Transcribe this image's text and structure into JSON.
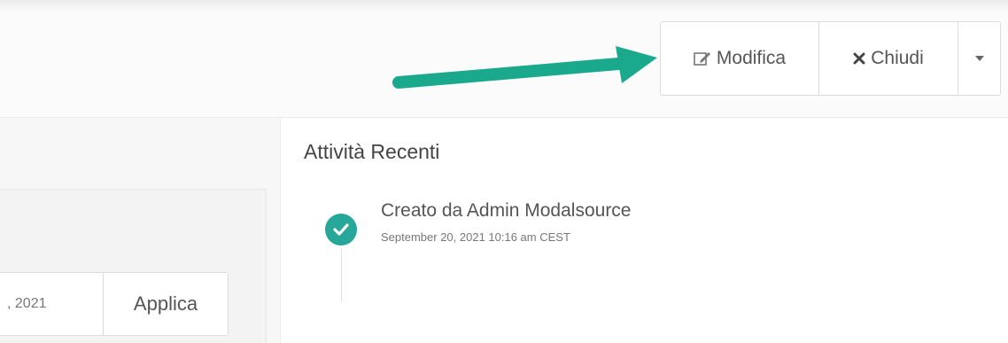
{
  "header": {
    "actions": {
      "edit_label": "Modifica",
      "close_label": "Chiudi"
    }
  },
  "filter": {
    "date_value": ", 2021",
    "apply_label": "Applica"
  },
  "activity": {
    "title": "Attività Recenti",
    "items": [
      {
        "text": "Creato da Admin Modalsource",
        "time": "September 20, 2021 10:16 am CEST"
      }
    ]
  },
  "colors": {
    "arrow": "#1aa98c",
    "check": "#26a79a"
  }
}
